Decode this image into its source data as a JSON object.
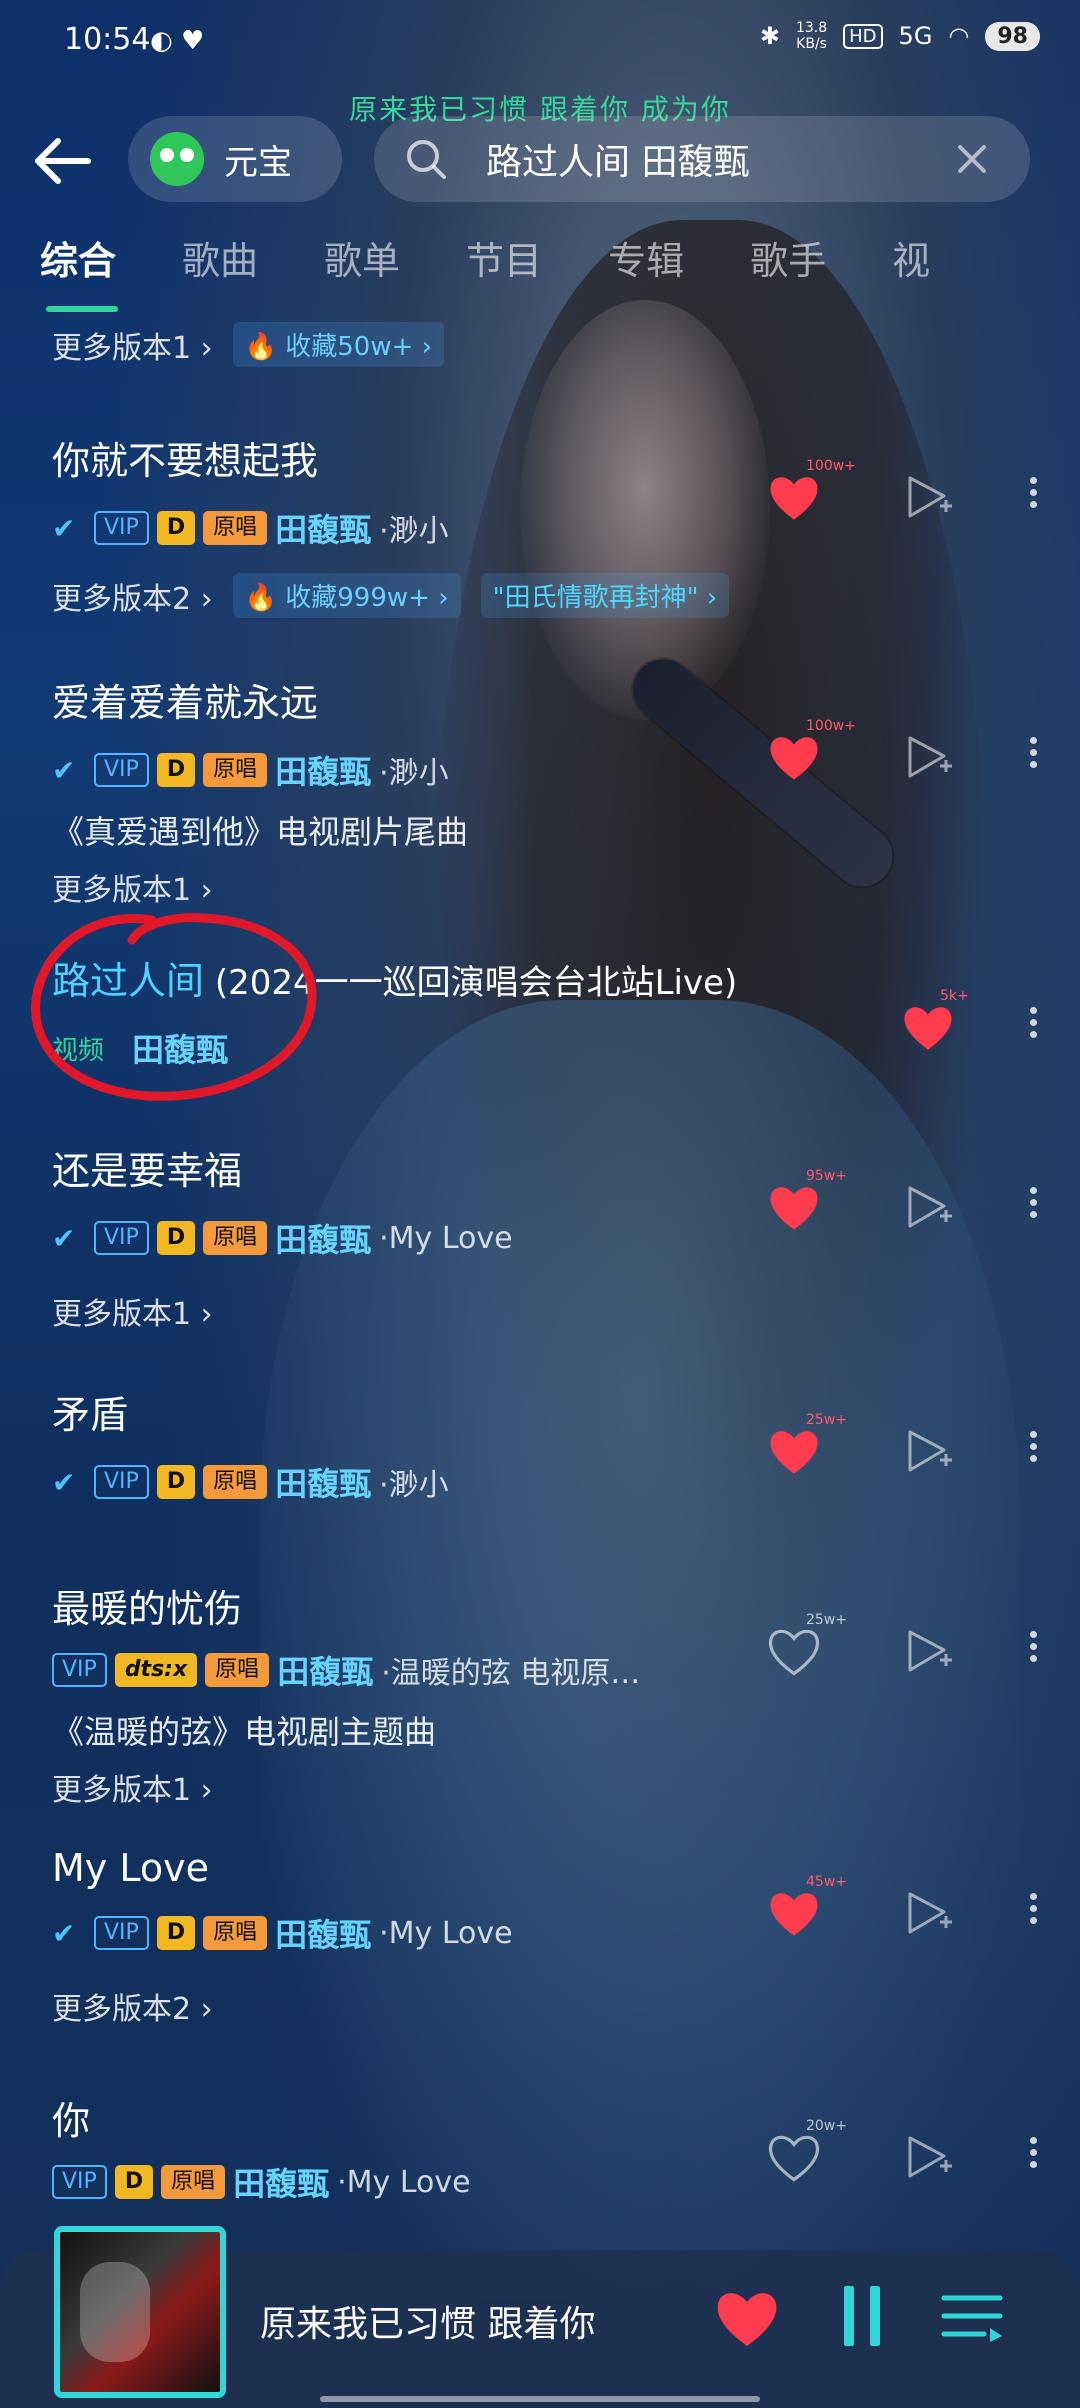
{
  "status_bar": {
    "time": "10:54",
    "net_speed_value": "13.8",
    "net_speed_unit": "KB/s",
    "hd": "HD",
    "signal": "5G",
    "battery": "98"
  },
  "lyric_banner": "原来我已习惯 跟着你 成为你",
  "header": {
    "assistant_label": "元宝",
    "search_query": "路过人间 田馥甄"
  },
  "tabs": [
    "综合",
    "歌曲",
    "歌单",
    "节目",
    "专辑",
    "歌手",
    "视"
  ],
  "top_more": {
    "label": "更多版本1 ›",
    "chip": "🔥 收藏50w+ ›"
  },
  "songs": [
    {
      "title": "你就不要想起我",
      "tags": [
        "VIP",
        "D",
        "原唱"
      ],
      "artist": "田馥甄",
      "album": "·渺小",
      "heart_count": "100w+",
      "more": "更多版本2 ›",
      "more_chips": [
        "🔥 收藏999w+ ›",
        "\"田氏情歌再封神\" ›"
      ]
    },
    {
      "title": "爱着爱着就永远",
      "tags": [
        "VIP",
        "D",
        "原唱"
      ],
      "artist": "田馥甄",
      "album": "·渺小",
      "heart_count": "100w+",
      "sub": "《真爱遇到他》电视剧片尾曲",
      "more": "更多版本1 ›"
    },
    {
      "title_highlight": "路过人间",
      "title_rest": " (2024一一巡回演唱会台北站Live)",
      "video_tag": "视频",
      "artist": "田馥甄",
      "heart_count": "5k+"
    },
    {
      "title": "还是要幸福",
      "tags": [
        "VIP",
        "D",
        "原唱"
      ],
      "artist": "田馥甄",
      "album": "·My Love",
      "heart_count": "95w+",
      "more": "更多版本1 ›"
    },
    {
      "title": "矛盾",
      "tags": [
        "VIP",
        "D",
        "原唱"
      ],
      "artist": "田馥甄",
      "album": "·渺小",
      "heart_count": "25w+"
    },
    {
      "title": "最暖的忧伤",
      "tags": [
        "VIP",
        "dts:x",
        "原唱"
      ],
      "artist": "田馥甄",
      "album": "·温暖的弦 电视原…",
      "heart_count": "25w+",
      "sub": "《温暖的弦》电视剧主题曲",
      "more": "更多版本1 ›"
    },
    {
      "title": "My Love",
      "tags": [
        "VIP",
        "D",
        "原唱"
      ],
      "artist": "田馥甄",
      "album": "·My Love",
      "heart_count": "45w+",
      "more": "更多版本2 ›"
    },
    {
      "title": "你",
      "tags": [
        "VIP",
        "D",
        "原唱"
      ],
      "artist": "田馥甄",
      "album": "·My Love",
      "heart_count": "20w+"
    }
  ],
  "mini_player": {
    "title": "原来我已习惯 跟着你"
  },
  "colors": {
    "accent": "#2fd79a",
    "link": "#4fd2ff",
    "heart": "#ff3b4e"
  }
}
